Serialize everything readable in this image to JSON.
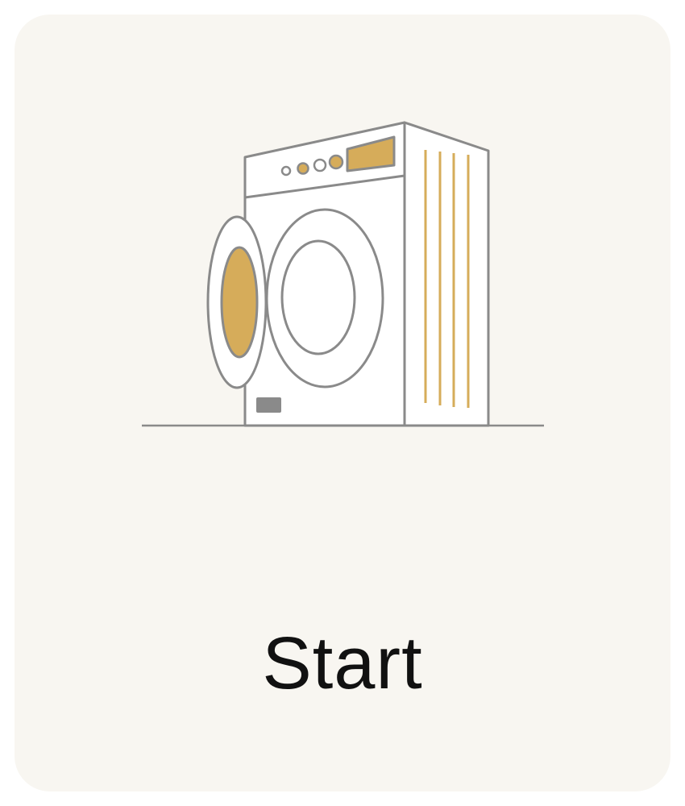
{
  "tile": {
    "label": "Start",
    "icon": "washing-machine-icon"
  },
  "colors": {
    "card_background": "#f8f6f1",
    "outline": "#8a8a8a",
    "accent": "#d6ac5a",
    "text": "#111111"
  }
}
